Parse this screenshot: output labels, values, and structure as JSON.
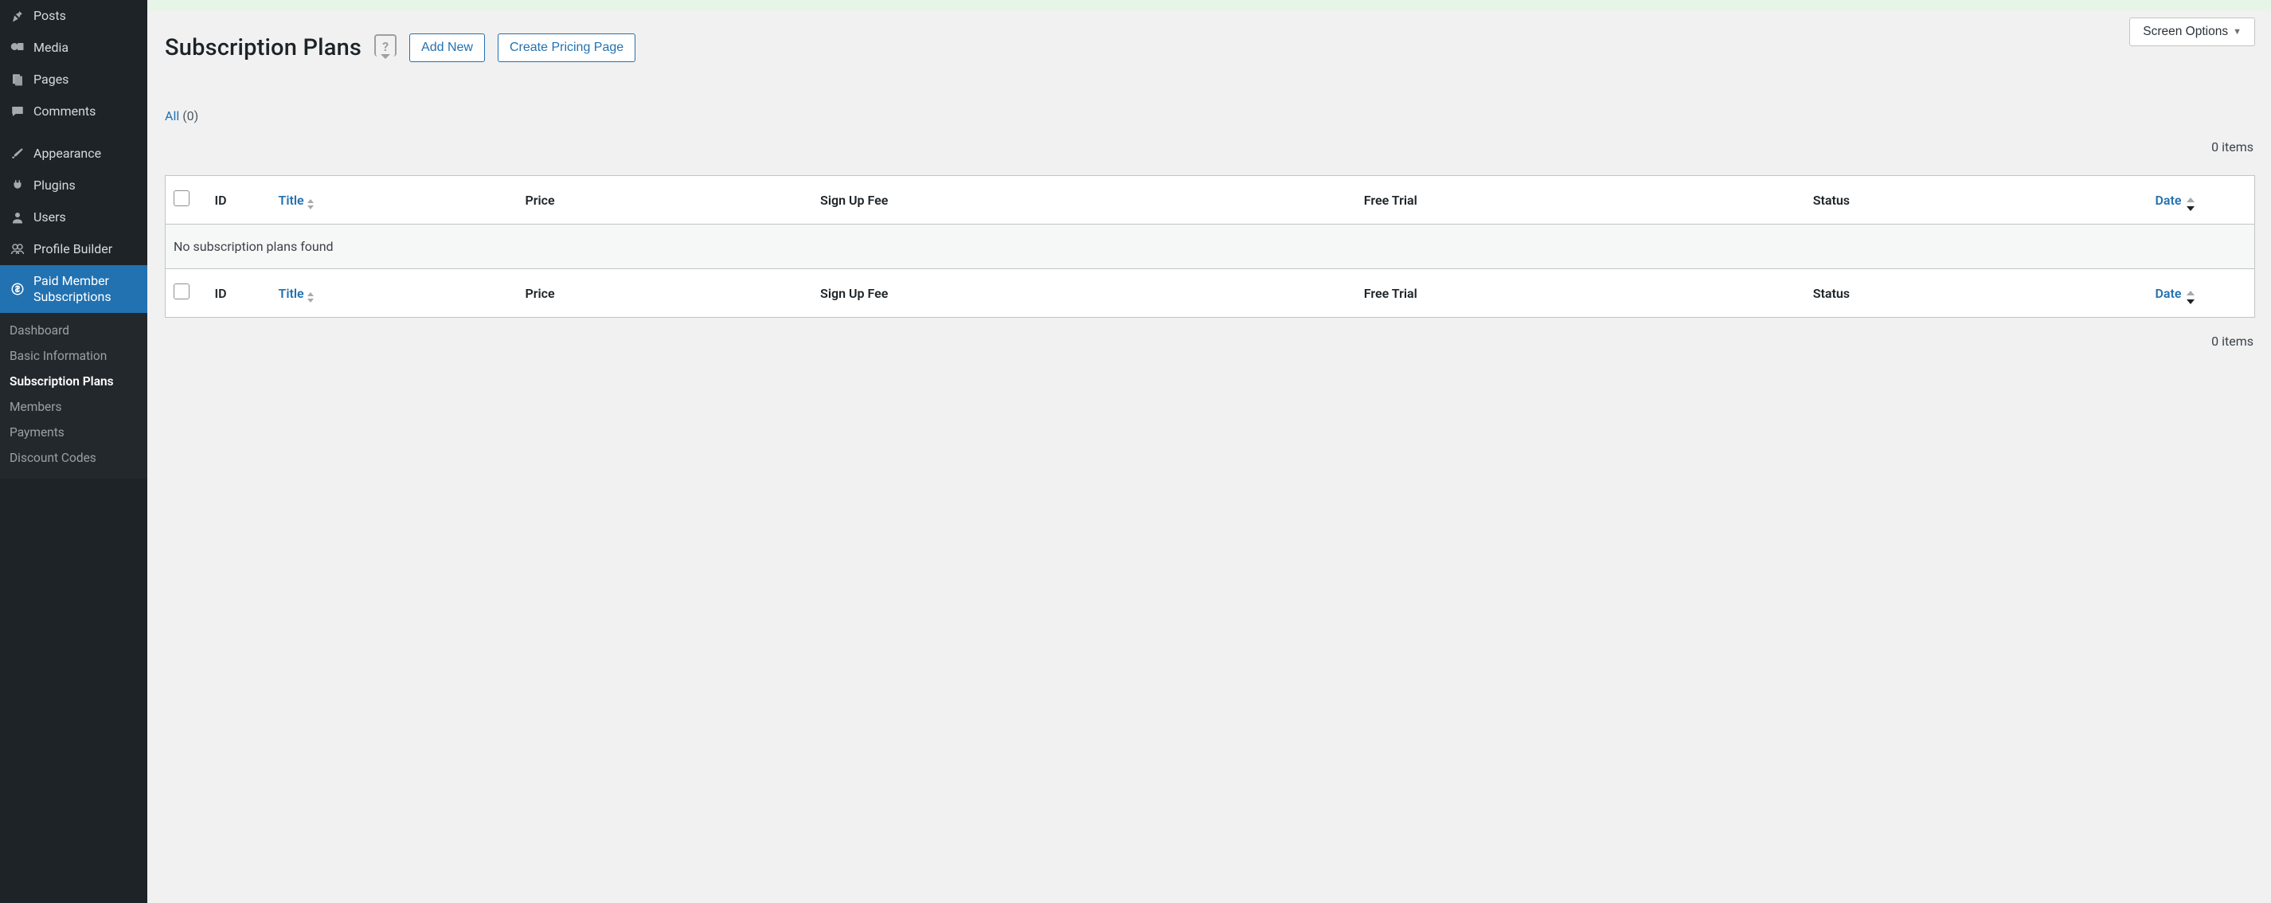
{
  "sidebar": {
    "items": [
      {
        "label": "Posts"
      },
      {
        "label": "Media"
      },
      {
        "label": "Pages"
      },
      {
        "label": "Comments"
      },
      {
        "label": "Appearance"
      },
      {
        "label": "Plugins"
      },
      {
        "label": "Users"
      },
      {
        "label": "Profile Builder"
      },
      {
        "label": "Paid Member Subscriptions"
      }
    ],
    "submenu": [
      {
        "label": "Dashboard"
      },
      {
        "label": "Basic Information"
      },
      {
        "label": "Subscription Plans"
      },
      {
        "label": "Members"
      },
      {
        "label": "Payments"
      },
      {
        "label": "Discount Codes"
      }
    ]
  },
  "header": {
    "title": "Subscription Plans",
    "add_new": "Add New",
    "create_pricing": "Create Pricing Page",
    "screen_options": "Screen Options"
  },
  "filters": {
    "all_label": "All",
    "all_count": "(0)"
  },
  "table": {
    "items_text_top": "0 items",
    "items_text_bottom": "0 items",
    "columns": {
      "id": "ID",
      "title": "Title",
      "price": "Price",
      "signup_fee": "Sign Up Fee",
      "free_trial": "Free Trial",
      "status": "Status",
      "date": "Date"
    },
    "empty_message": "No subscription plans found"
  }
}
